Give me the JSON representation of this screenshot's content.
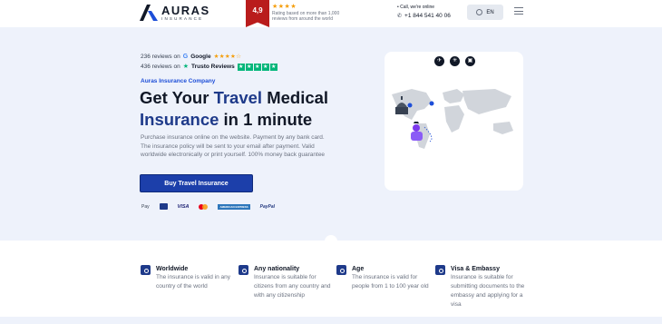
{
  "header": {
    "logo_name": "AURAS",
    "logo_sub": "INSURANCE",
    "rating_value": "4,9",
    "rating_stars": "★★★★",
    "rating_text": "Rating based on more than 1,000 reviews from around the world",
    "call_label": "• Call, we're online",
    "phone": "+1 844 541 40 06",
    "lang": "EN"
  },
  "hero": {
    "google_reviews": "236 reviews on",
    "google_brand": "Google",
    "google_stars": "★★★★☆",
    "trust_reviews": "436 reviews on",
    "trust_brand": "Trustо Reviews",
    "company": "Auras Insurance Company",
    "title_part1": "Get Your ",
    "title_accent1": "Travel",
    "title_part2": " Medical",
    "title_accent2": "Insurance",
    "title_part3": " in 1 minute",
    "description": "Purchase insurance online on the website. Payment by any bank card. The insurance policy will be sent to your email after payment. Valid worldwide electronically or print yourself. 100% money back guarantee",
    "buy_button": "Buy Travel Insurance",
    "payments": {
      "applepay": "Pay",
      "visa": "VISA",
      "amex": "AMERICAN EXPRESS",
      "paypal": "PayPal"
    }
  },
  "features": [
    {
      "title": "Worldwide",
      "text": "The insurance is valid in any country of the world"
    },
    {
      "title": "Any nationality",
      "text": "Insurance is suitable for citizens from any country and with any citizenship"
    },
    {
      "title": "Age",
      "text": "The insurance is valid for people from 1 to 100 year old"
    },
    {
      "title": "Visa & Embassy",
      "text": "Insurance is suitable for submitting documents to the embassy and applying for a visa"
    }
  ],
  "colors": {
    "accent": "#1e3a8a",
    "hero_bg": "#eef2fb",
    "ribbon": "#b91c1c"
  }
}
